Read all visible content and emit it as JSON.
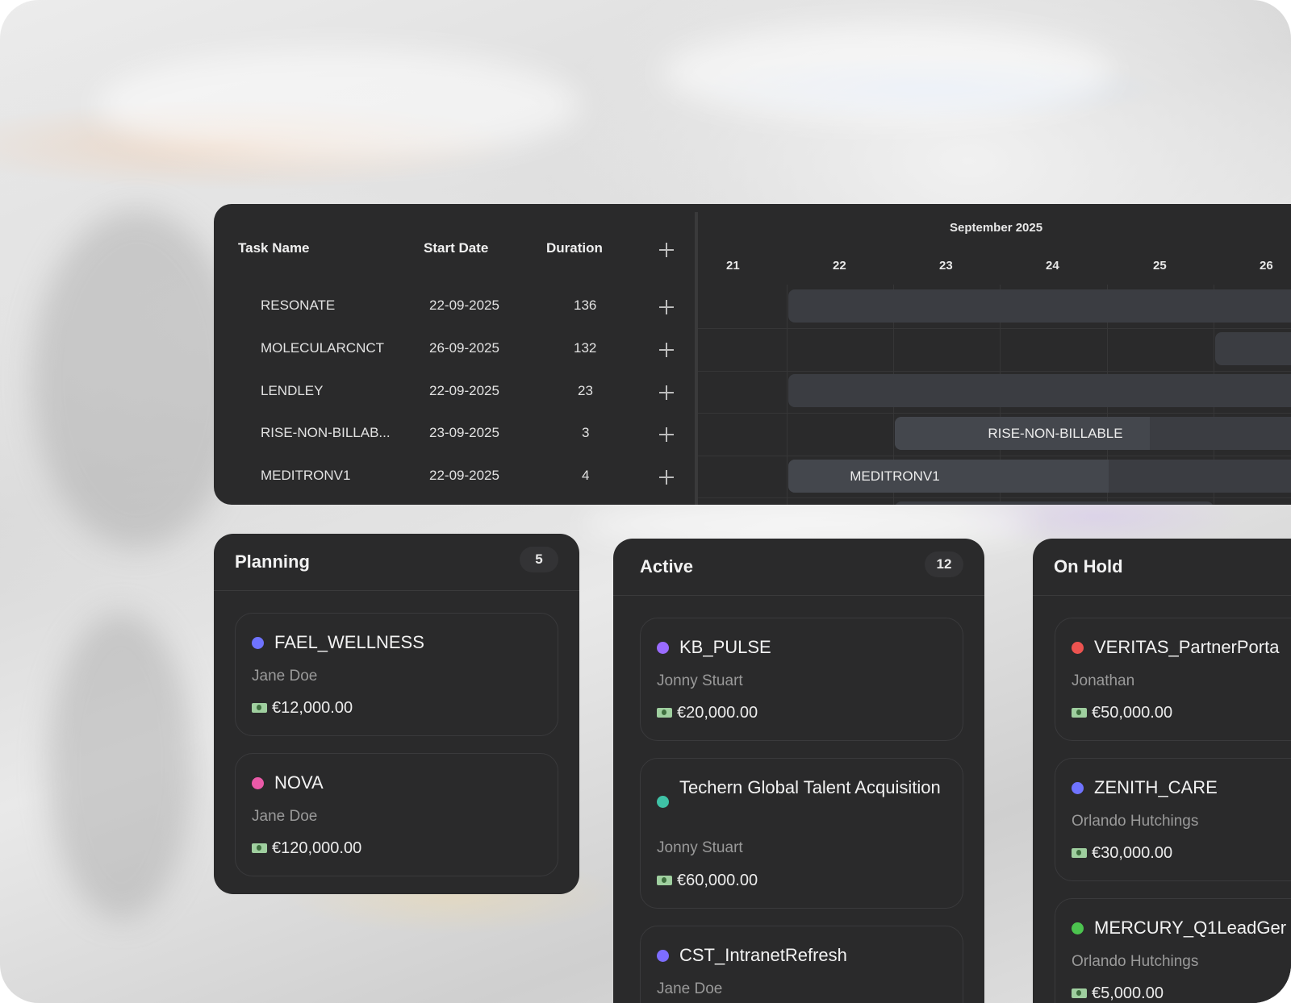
{
  "gantt": {
    "headers": {
      "task_name": "Task Name",
      "start_date": "Start Date",
      "duration": "Duration"
    },
    "month": "September 2025",
    "days": [
      "21",
      "22",
      "23",
      "24",
      "25",
      "26"
    ],
    "rows": [
      {
        "name": "RESONATE",
        "start": "22-09-2025",
        "duration": "136"
      },
      {
        "name": "MOLECULARCNCT",
        "start": "26-09-2025",
        "duration": "132"
      },
      {
        "name": "LENDLEY",
        "start": "22-09-2025",
        "duration": "23"
      },
      {
        "name": "RISE-NON-BILLAB...",
        "start": "23-09-2025",
        "duration": "3"
      },
      {
        "name": "MEDITRONV1",
        "start": "22-09-2025",
        "duration": "4"
      }
    ],
    "bar_labels": {
      "rise": "RISE-NON-BILLABLE",
      "meditron": "MEDITRONV1"
    }
  },
  "kanban": {
    "planning": {
      "title": "Planning",
      "count": "5",
      "cards": [
        {
          "title": "FAEL_WELLNESS",
          "owner": "Jane Doe",
          "amount": "€12,000.00",
          "color": "#6f73ff"
        },
        {
          "title": "NOVA",
          "owner": "Jane Doe",
          "amount": "€120,000.00",
          "color": "#ea5aa8"
        }
      ]
    },
    "active": {
      "title": "Active",
      "count": "12",
      "cards": [
        {
          "title": "KB_PULSE",
          "owner": "Jonny Stuart",
          "amount": "€20,000.00",
          "color": "#9a6bff"
        },
        {
          "title": "Techern Global Talent Acquisition",
          "owner": "Jonny Stuart",
          "amount": "€60,000.00",
          "color": "#3fc2a6"
        },
        {
          "title": "CST_IntranetRefresh",
          "owner": "Jane Doe",
          "amount": "",
          "color": "#7d6dff"
        }
      ]
    },
    "on_hold": {
      "title": "On Hold",
      "cards": [
        {
          "title": "VERITAS_PartnerPorta",
          "owner": "Jonathan",
          "amount": "€50,000.00",
          "color": "#ec5350"
        },
        {
          "title": "ZENITH_CARE",
          "owner": "Orlando Hutchings",
          "amount": "€30,000.00",
          "color": "#6f73ff"
        },
        {
          "title": "MERCURY_Q1LeadGer",
          "owner": "Orlando Hutchings",
          "amount": "€5,000.00",
          "color": "#4cc44f"
        }
      ]
    }
  }
}
